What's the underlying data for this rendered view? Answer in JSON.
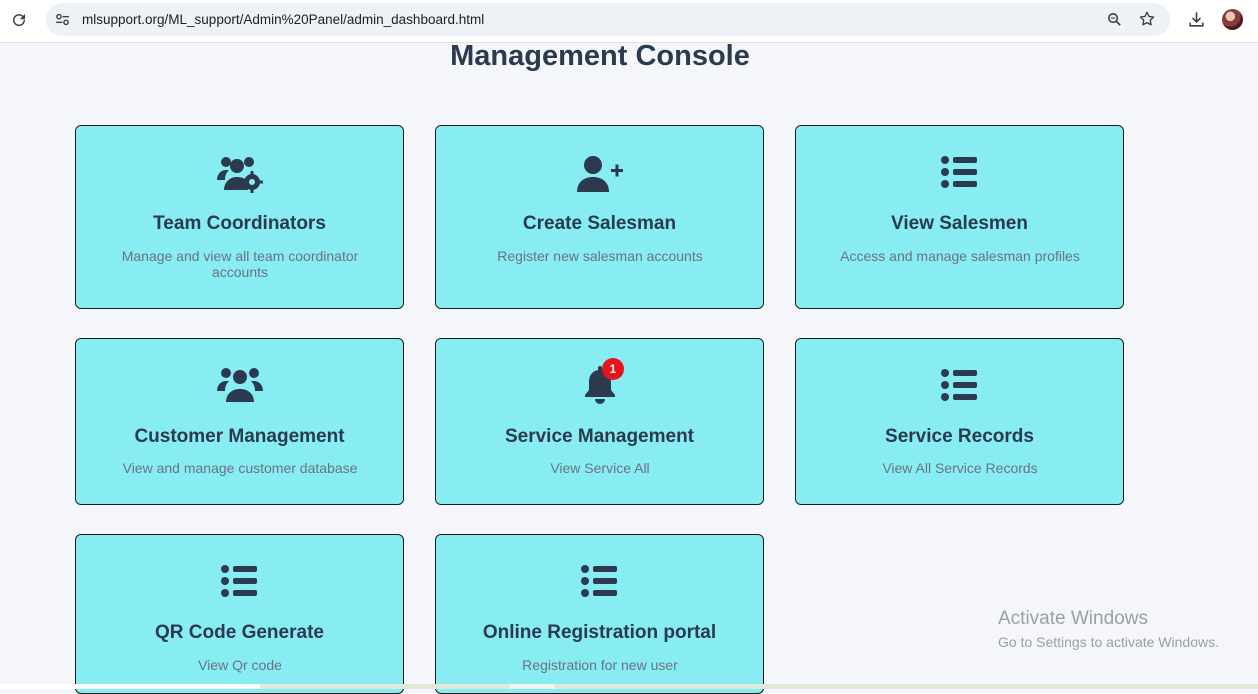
{
  "browser": {
    "url": "mlsupport.org/ML_support/Admin%20Panel/admin_dashboard.html",
    "icons": [
      "reload-icon",
      "site-info-icon",
      "zoom-icon",
      "bookmark-star-icon",
      "download-icon",
      "profile-avatar"
    ]
  },
  "page": {
    "title": "Management Console"
  },
  "cards": [
    {
      "icon": "users-gear-icon",
      "title": "Team Coordinators",
      "desc": "Manage and view all team coordinator accounts"
    },
    {
      "icon": "user-plus-icon",
      "title": "Create Salesman",
      "desc": "Register new salesman accounts"
    },
    {
      "icon": "list-icon",
      "title": "View Salesmen",
      "desc": "Access and manage salesman profiles"
    },
    {
      "icon": "users-icon",
      "title": "Customer Management",
      "desc": "View and manage customer database"
    },
    {
      "icon": "bell-icon",
      "title": "Service Management",
      "desc": "View Service All",
      "badge": "1"
    },
    {
      "icon": "list-icon",
      "title": "Service Records",
      "desc": "View All Service Records"
    },
    {
      "icon": "list-icon",
      "title": "QR Code Generate",
      "desc": "View Qr code"
    },
    {
      "icon": "list-icon",
      "title": "Online Registration portal",
      "desc": "Registration for new user"
    }
  ],
  "colors": {
    "card_bg": "#87edf2",
    "text_dark": "#2b3a4e",
    "badge": "#e8141c"
  },
  "watermark": {
    "title": "Activate Windows",
    "subtitle": "Go to Settings to activate Windows."
  }
}
